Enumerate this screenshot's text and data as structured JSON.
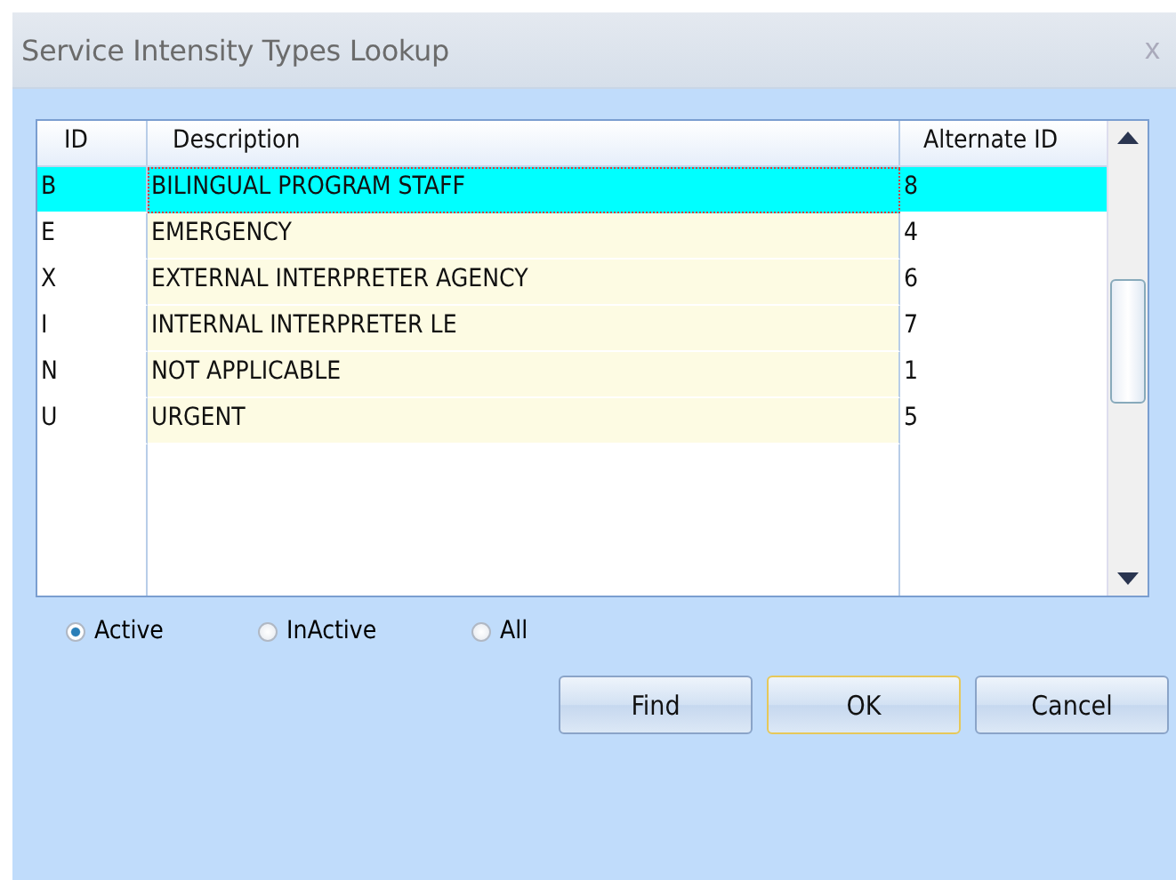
{
  "window": {
    "title": "Service Intensity Types Lookup",
    "close": "x"
  },
  "table": {
    "columns": [
      "ID",
      "Description",
      "Alternate ID"
    ],
    "rows": [
      {
        "cells": [
          "B",
          "BILINGUAL PROGRAM STAFF",
          "8"
        ],
        "selected": true
      },
      {
        "cells": [
          "E",
          "EMERGENCY",
          "4"
        ],
        "selected": false
      },
      {
        "cells": [
          "X",
          "EXTERNAL INTERPRETER AGENCY",
          "6"
        ],
        "selected": false
      },
      {
        "cells": [
          "I",
          "INTERNAL INTERPRETER LE",
          "7"
        ],
        "selected": false
      },
      {
        "cells": [
          "N",
          "NOT APPLICABLE",
          "1"
        ],
        "selected": false
      },
      {
        "cells": [
          "U",
          "URGENT",
          "5"
        ],
        "selected": false
      }
    ]
  },
  "filters": [
    {
      "label": "Active",
      "selected": true
    },
    {
      "label": "InActive",
      "selected": false
    },
    {
      "label": "All",
      "selected": false
    }
  ],
  "buttons": [
    {
      "label": "Find",
      "default": false
    },
    {
      "label": "OK",
      "default": true
    },
    {
      "label": "Cancel",
      "default": false
    }
  ]
}
